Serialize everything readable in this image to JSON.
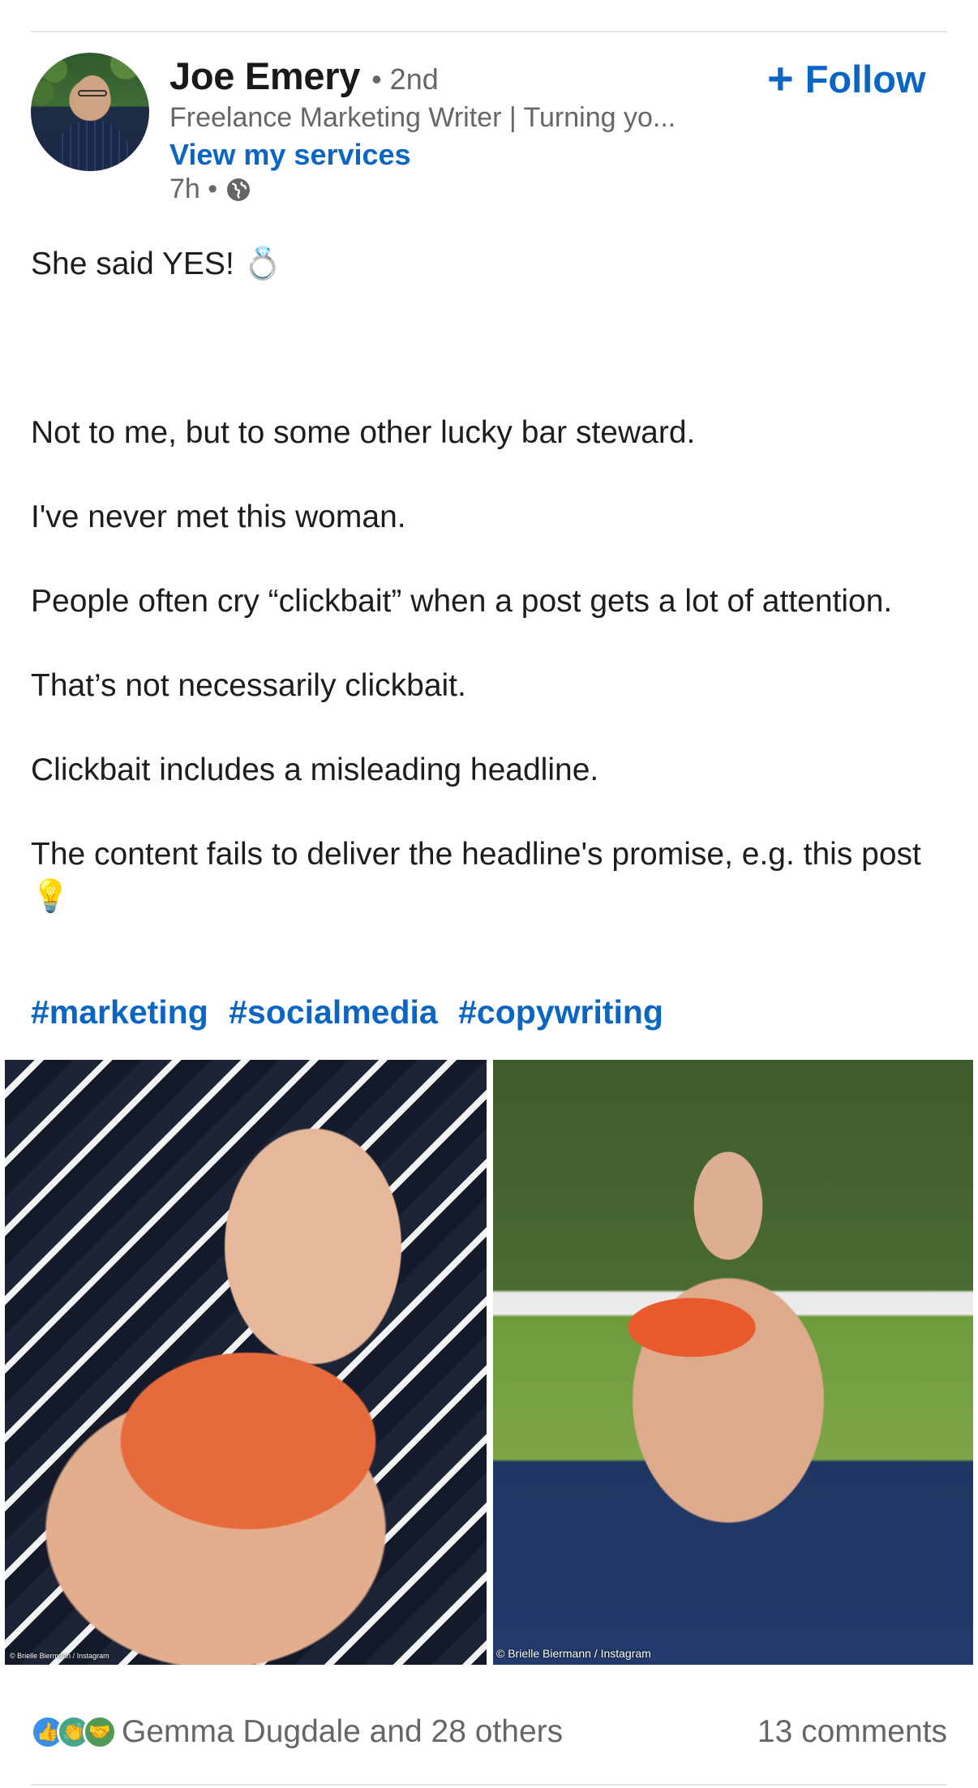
{
  "author": {
    "name": "Joe Emery",
    "degree": "• 2nd",
    "headline": "Freelance Marketing Writer | Turning yo...",
    "services_link": "View my services",
    "time": "7h •",
    "visibility_icon": "globe-icon"
  },
  "follow": {
    "plus": "+",
    "label": "Follow"
  },
  "post": {
    "paragraphs": [
      "She said YES! 💍",
      "",
      "",
      "Not to me, but to some other lucky bar steward.",
      "",
      "I've never met this woman.",
      "",
      "People often cry “clickbait” when a post gets a lot of attention.",
      "",
      "That’s not necessarily clickbait.",
      "",
      "Clickbait includes a misleading headline.",
      "",
      "The content fails to deliver the headline's promise, e.g. this post 💡"
    ],
    "hashtags": [
      "#marketing",
      "#socialmedia",
      "#copywriting"
    ]
  },
  "images": [
    {
      "credit": "© Brielle Biermann / Instagram"
    },
    {
      "credit": "© Brielle Biermann / Instagram"
    }
  ],
  "social": {
    "reaction_icons": [
      "like-icon",
      "celebrate-icon",
      "support-icon"
    ],
    "reactions_text": "Gemma Dugdale and 28 others",
    "comments_text": "13 comments"
  },
  "colors": {
    "link": "#0a66c2",
    "secondary_text": "#666666"
  }
}
